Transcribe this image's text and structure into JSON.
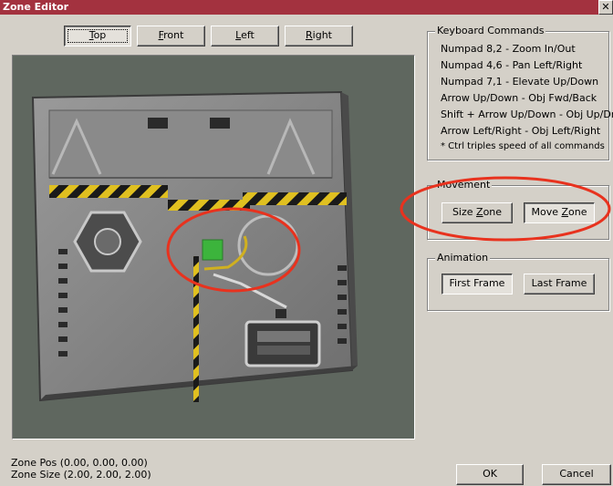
{
  "window": {
    "title": "Zone Editor",
    "close_glyph": "✕"
  },
  "view_buttons": [
    {
      "key": "T",
      "rest": "op"
    },
    {
      "key": "F",
      "rest": "ront"
    },
    {
      "key": "L",
      "rest": "eft"
    },
    {
      "key": "R",
      "rest": "ight"
    }
  ],
  "keyboard": {
    "title": "Keyboard Commands",
    "lines": [
      "Numpad 8,2 - Zoom In/Out",
      "Numpad 4,6 - Pan Left/Right",
      "Numpad 7,1 - Elevate Up/Down",
      "Arrow Up/Down - Obj Fwd/Back",
      "Shift + Arrow Up/Down - Obj Up/Dn",
      "Arrow Left/Right - Obj Left/Right",
      "* Ctrl triples speed of all commands"
    ]
  },
  "movement": {
    "title": "Movement",
    "size_pre": "Size ",
    "size_key": "Z",
    "size_post": "one",
    "move_pre": "Move ",
    "move_key": "Z",
    "move_post": "one"
  },
  "animation": {
    "title": "Animation",
    "first": "First Frame",
    "last": "Last Frame"
  },
  "status": {
    "pos": "Zone Pos (0.00, 0.00, 0.00)",
    "size": "Zone Size (2.00, 2.00, 2.00)"
  },
  "dialog": {
    "ok": "OK",
    "cancel": "Cancel"
  },
  "colors": {
    "title_bar": "#a3323f",
    "annotation": "#e8321e",
    "zone_marker": "#3cb43c",
    "viewport_bg": "#5f675f"
  }
}
